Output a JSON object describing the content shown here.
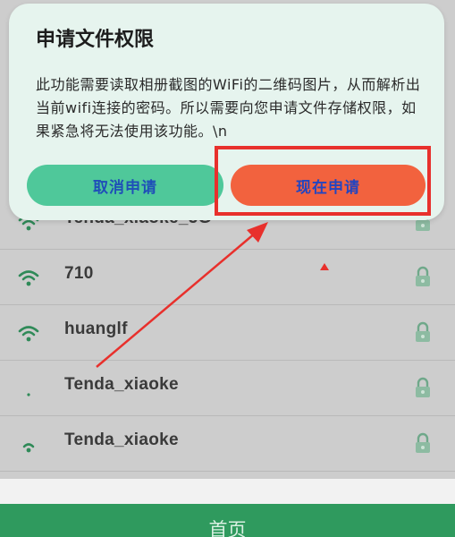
{
  "dialog": {
    "title": "申请文件权限",
    "message": "此功能需要读取相册截图的WiFi的二维码图片，从而解析出当前wifi连接的密码。所以需要向您申请文件存储权限，如果紧急将无法使用该功能。\\n",
    "cancel_label": "取消申请",
    "apply_label": "现在申请"
  },
  "wifi_list": [
    {
      "ssid": "Tenda_xiaoke_5G",
      "icon": "wifi-signal-icon",
      "locked": true
    },
    {
      "ssid": "710",
      "icon": "wifi-signal-icon",
      "locked": true
    },
    {
      "ssid": "huanglf",
      "icon": "wifi-signal-icon",
      "locked": true
    },
    {
      "ssid": "Tenda_xiaoke",
      "icon": "wifi-signal-weak-icon",
      "locked": true
    },
    {
      "ssid": "Tenda_xiaoke",
      "icon": "wifi-signal-icon",
      "locked": true
    }
  ],
  "bottom_nav": {
    "home_label": "首页"
  },
  "colors": {
    "accent_green": "#2f9a5e",
    "cancel_button": "#4fc89a",
    "apply_button": "#f2623e",
    "annotation_red": "#e8302c",
    "dialog_bg": "#e6f4ee"
  }
}
